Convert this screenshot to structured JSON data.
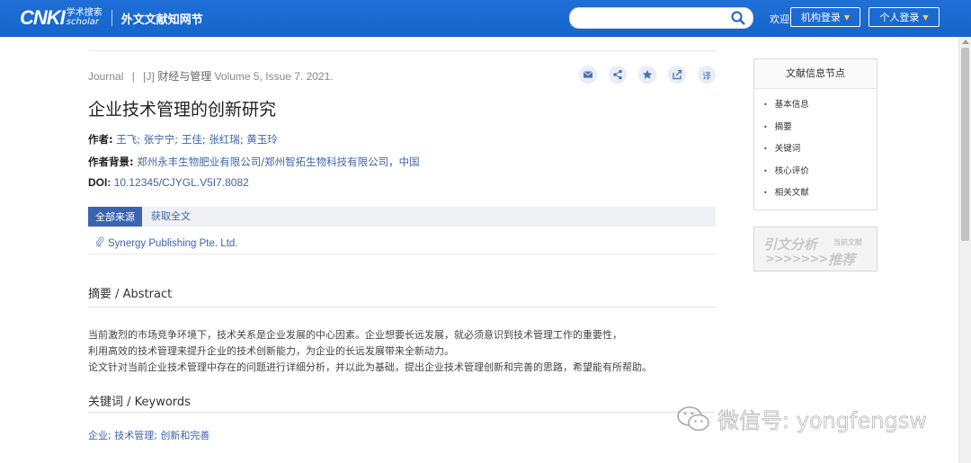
{
  "header": {
    "logo_cnki": "CNKI",
    "logo_scholar_cn": "学术搜索",
    "logo_scholar_en": "scholar",
    "subtitle": "外文文献知网节",
    "search_placeholder": "",
    "welcome": "欢迎",
    "institution_login": "机构登录",
    "personal_login": "个人登录"
  },
  "article": {
    "type": "Journal",
    "tag": "[J]",
    "journal": "财经与管理",
    "volume_issue": "Volume 5, Issue 7. 2021.",
    "title": "企业技术管理的创新研究",
    "authors_label": "作者:",
    "authors": "王飞; 张宁宁; 王佳; 张红瑞; 黄玉玲",
    "affiliation_label": "作者背景:",
    "affiliation": "郑州永丰生物肥业有限公司/郑州智拓生物科技有限公司，中国",
    "doi_label": "DOI:",
    "doi": "10.12345/CJYGL.V5I7.8082"
  },
  "tools": {
    "mail_icon": "mail-icon",
    "share_icon": "share-icon",
    "star_icon": "star-icon",
    "export_icon": "export-icon",
    "translate_label": "译"
  },
  "sources": {
    "tab_all": "全部来源",
    "tab_fulltext": "获取全文",
    "publisher": "Synergy Publishing Pte. Ltd."
  },
  "abstract": {
    "heading": "摘要 / Abstract",
    "lines": [
      "当前激烈的市场竞争环境下，技术关系是企业发展的中心因素。企业想要长远发展，就必须意识到技术管理工作的重要性，",
      "利用高效的技术管理来提升企业的技术创新能力，为企业的长远发展带来全新动力。",
      "论文针对当前企业技术管理中存在的问题进行详细分析，并以此为基础，提出企业技术管理创新和完善的思路，希望能有所帮助。"
    ]
  },
  "keywords": {
    "heading": "关键词 / Keywords",
    "items": "企业; 技术管理; 创新和完善"
  },
  "sidebar": {
    "title": "文献信息节点",
    "items": [
      "基本信息",
      "摘要",
      "关键词",
      "核心评价",
      "相关文献"
    ]
  },
  "citation_banner": {
    "big": "引文分析",
    "small": "当前文献",
    "arrows": ">>>>>>>",
    "recommend": "推荐"
  },
  "watermark": {
    "text": "微信号: yongfengsw"
  },
  "colors": {
    "header_blue": "#1f6fd6",
    "link_blue": "#3f64a8",
    "tab_active": "#3a64b0"
  }
}
